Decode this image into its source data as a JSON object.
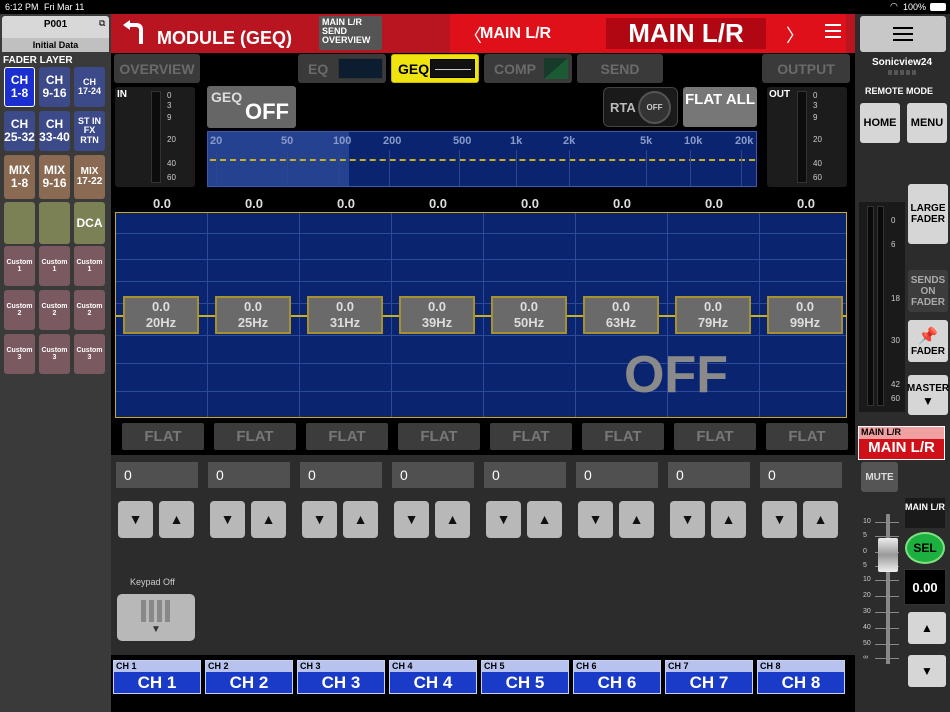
{
  "status": {
    "time": "6:12 PM",
    "date": "Fri Mar 11",
    "battery": "100%"
  },
  "scene": {
    "number": "P001",
    "name": "Initial Data"
  },
  "fader_layer": {
    "title": "FADER LAYER",
    "buttons": [
      {
        "l1": "CH",
        "l2": "1-8"
      },
      {
        "l1": "CH",
        "l2": "9-16"
      },
      {
        "l1": "CH",
        "l2": "17-24"
      },
      {
        "l1": "CH",
        "l2": "25-32"
      },
      {
        "l1": "CH",
        "l2": "33-40"
      },
      {
        "l1": "ST IN",
        "l2": "FX RTN"
      },
      {
        "l1": "MIX",
        "l2": "1-8"
      },
      {
        "l1": "MIX",
        "l2": "9-16"
      },
      {
        "l1": "MIX",
        "l2": "17-22"
      },
      {
        "l1": "",
        "l2": ""
      },
      {
        "l1": "",
        "l2": ""
      },
      {
        "l1": "DCA",
        "l2": ""
      },
      {
        "l1": "Custom",
        "l2": "1"
      },
      {
        "l1": "Custom",
        "l2": "1"
      },
      {
        "l1": "Custom",
        "l2": "1"
      },
      {
        "l1": "Custom",
        "l2": "2"
      },
      {
        "l1": "Custom",
        "l2": "2"
      },
      {
        "l1": "Custom",
        "l2": "2"
      },
      {
        "l1": "Custom",
        "l2": "3"
      },
      {
        "l1": "Custom",
        "l2": "3"
      },
      {
        "l1": "Custom",
        "l2": "3"
      }
    ]
  },
  "header": {
    "title": "MODULE (GEQ)",
    "send_overview": "MAIN L/R SEND OVERVIEW",
    "channel_small": "MAIN L/R",
    "channel_big": "MAIN L/R"
  },
  "tabs": {
    "overview": "OVERVIEW",
    "eq": "EQ",
    "geq": "GEQ",
    "comp": "COMP",
    "send": "SEND",
    "output": "OUTPUT"
  },
  "geq": {
    "toggle_label": "GEQ",
    "toggle_state": "OFF",
    "rta_label": "RTA",
    "rta_state": "OFF",
    "flat_all": "FLAT ALL",
    "off_overlay": "OFF"
  },
  "meters": {
    "in_label": "IN",
    "out_label": "OUT",
    "scale": [
      "0",
      "3",
      "9",
      "20",
      "40",
      "60"
    ]
  },
  "freq_axis": [
    "20",
    "50",
    "100",
    "200",
    "500",
    "1k",
    "2k",
    "5k",
    "10k",
    "20k"
  ],
  "bands": [
    {
      "value": "0.0",
      "freq": "20Hz",
      "gain": "0"
    },
    {
      "value": "0.0",
      "freq": "25Hz",
      "gain": "0"
    },
    {
      "value": "0.0",
      "freq": "31Hz",
      "gain": "0"
    },
    {
      "value": "0.0",
      "freq": "39Hz",
      "gain": "0"
    },
    {
      "value": "0.0",
      "freq": "50Hz",
      "gain": "0"
    },
    {
      "value": "0.0",
      "freq": "63Hz",
      "gain": "0"
    },
    {
      "value": "0.0",
      "freq": "79Hz",
      "gain": "0"
    },
    {
      "value": "0.0",
      "freq": "99Hz",
      "gain": "0"
    }
  ],
  "flat_label": "FLAT",
  "keypad_label": "Keypad Off",
  "channels": [
    {
      "small": "CH 1",
      "big": "CH 1"
    },
    {
      "small": "CH 2",
      "big": "CH 2"
    },
    {
      "small": "CH 3",
      "big": "CH 3"
    },
    {
      "small": "CH 4",
      "big": "CH 4"
    },
    {
      "small": "CH 5",
      "big": "CH 5"
    },
    {
      "small": "CH 6",
      "big": "CH 6"
    },
    {
      "small": "CH 7",
      "big": "CH 7"
    },
    {
      "small": "CH 8",
      "big": "CH 8"
    }
  ],
  "right": {
    "device": "Sonicview24",
    "remote_mode": "REMOTE MODE",
    "home": "HOME",
    "menu": "MENU",
    "large_fader": "LARGE FADER",
    "sends_on_fader": "SENDS ON FADER",
    "fader": "FADER",
    "master": "MASTER",
    "main_small": "MAIN L/R",
    "main_big": "MAIN L/R",
    "mute": "MUTE",
    "main_lr_label": "MAIN L/R",
    "sel": "SEL",
    "fader_value": "0.00",
    "fader_scale": [
      "10",
      "5",
      "0",
      "5",
      "10",
      "20",
      "30",
      "40",
      "50",
      "∞"
    ],
    "meter_scale": [
      "0",
      "6",
      "18",
      "30",
      "42",
      "60"
    ]
  }
}
